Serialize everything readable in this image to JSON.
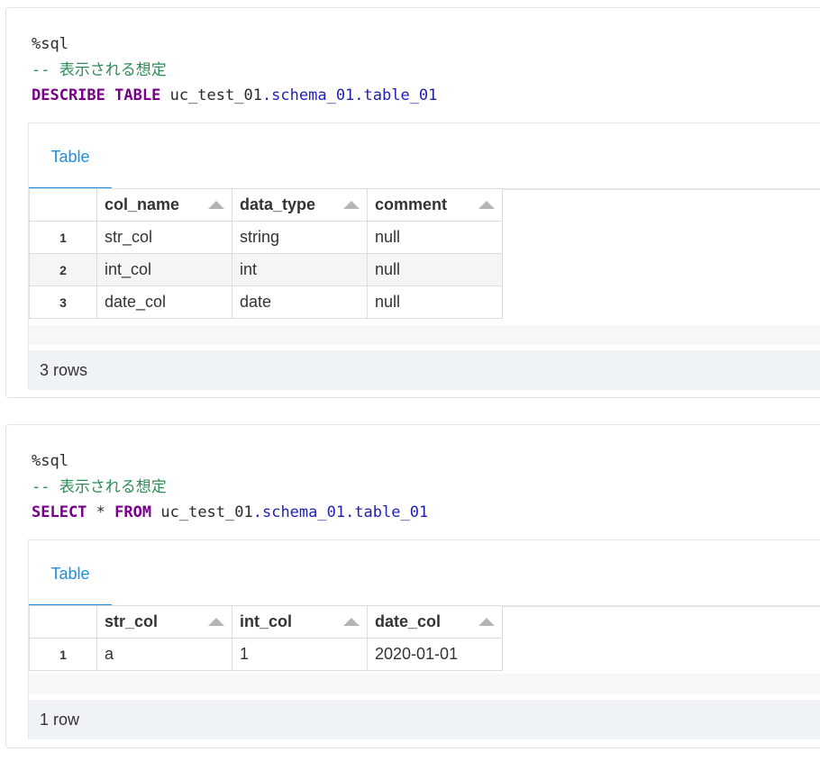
{
  "cells": [
    {
      "code": {
        "magic": "%sql",
        "comment": "-- 表示される想定",
        "kw1": "DESCRIBE",
        "kw2": "TABLE",
        "catalog": "uc_test_01",
        "rest": ".schema_01.table_01"
      },
      "result": {
        "tab_label": "Table",
        "columns": [
          "col_name",
          "data_type",
          "comment"
        ],
        "rows": [
          {
            "index": "1",
            "values": [
              "str_col",
              "string",
              "null"
            ]
          },
          {
            "index": "2",
            "values": [
              "int_col",
              "int",
              "null"
            ]
          },
          {
            "index": "3",
            "values": [
              "date_col",
              "date",
              "null"
            ]
          }
        ],
        "footer": "3 rows"
      }
    },
    {
      "code": {
        "magic": "%sql",
        "comment": "-- 表示される想定",
        "kw1": "SELECT",
        "star": "*",
        "kw2": "FROM",
        "catalog": "uc_test_01",
        "rest": ".schema_01.table_01"
      },
      "result": {
        "tab_label": "Table",
        "columns": [
          "str_col",
          "int_col",
          "date_col"
        ],
        "rows": [
          {
            "index": "1",
            "values": [
              "a",
              "1",
              "2020-01-01"
            ]
          }
        ],
        "footer": "1 row"
      }
    }
  ]
}
